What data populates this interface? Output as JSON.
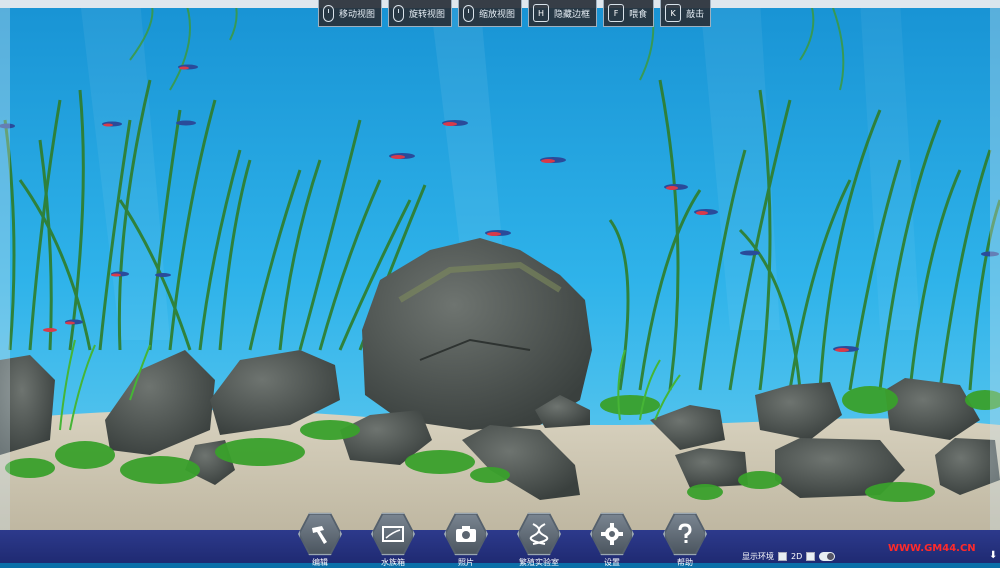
{
  "hints": [
    {
      "icon": "mouse-left-icon",
      "label": "移动视图"
    },
    {
      "icon": "mouse-right-icon",
      "label": "旋转视图"
    },
    {
      "icon": "mouse-wheel-icon",
      "label": "缩放视图"
    },
    {
      "key": "H",
      "label": "隐藏边框"
    },
    {
      "key": "F",
      "label": "喂食"
    },
    {
      "key": "K",
      "label": "敲击"
    }
  ],
  "toolbar": [
    {
      "icon": "hammer-icon",
      "label": "编辑"
    },
    {
      "icon": "aquarium-icon",
      "label": "水族箱"
    },
    {
      "icon": "camera-icon",
      "label": "照片"
    },
    {
      "icon": "dna-icon",
      "label": "繁殖实验室"
    },
    {
      "icon": "gear-icon",
      "label": "设置"
    },
    {
      "icon": "help-icon",
      "label": "帮助"
    }
  ],
  "environment": {
    "label": "显示环境",
    "mode_2d": "2D"
  },
  "watermark": "WWW.GM44.CN",
  "colors": {
    "water": "#1aa0df",
    "sand": "#cfc7b1",
    "bottom_bar": "#26328a"
  }
}
